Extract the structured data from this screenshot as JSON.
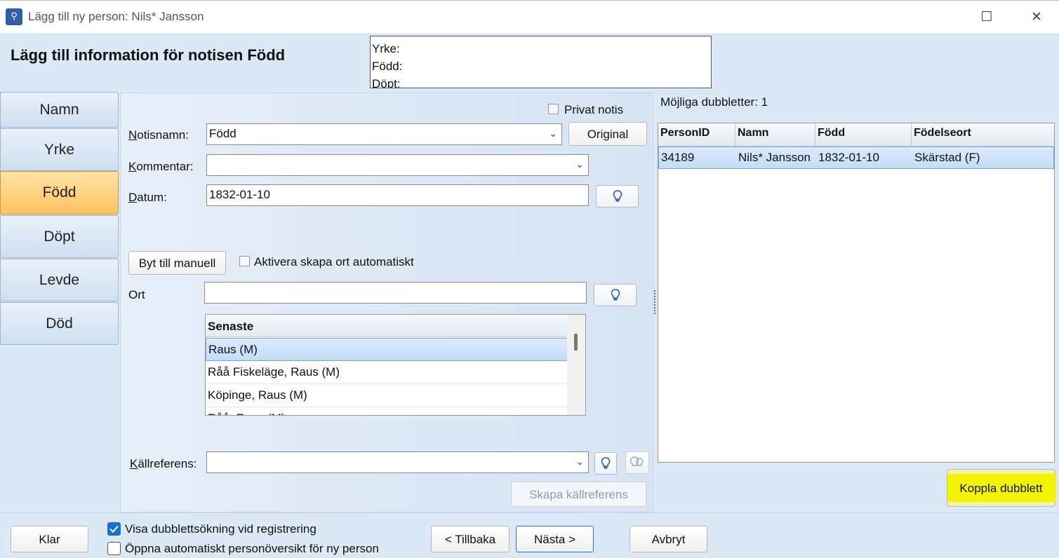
{
  "window": {
    "title": "Lägg till ny person: Nils* Jansson",
    "icon": "family-tree-icon",
    "minimize": "—",
    "maximize": "☐",
    "close": "✕"
  },
  "header": {
    "heading": "Lägg till information för notisen Född",
    "summary": [
      "Yrke:",
      "Född:",
      "Döpt:"
    ]
  },
  "nav": {
    "items": [
      {
        "label": "Namn",
        "active": false
      },
      {
        "label": "Yrke",
        "active": false
      },
      {
        "label": "Född",
        "active": true
      },
      {
        "label": "Döpt",
        "active": false
      },
      {
        "label": "Levde",
        "active": false
      },
      {
        "label": "Död",
        "active": false
      }
    ]
  },
  "form": {
    "private_label": "Privat notis",
    "notisnamn_label_u": "N",
    "notisnamn_label_rest": "otisnamn:",
    "notisnamn_value": "Född",
    "original_button": "Original",
    "kommentar_label_u": "K",
    "kommentar_label_rest": "ommentar:",
    "kommentar_value": "",
    "datum_label_u": "D",
    "datum_label_rest": "atum:",
    "datum_value": "1832-01-10",
    "manual_button": "Byt till manuell",
    "auto_place_label": "Aktivera skapa ort automatiskt",
    "ort_label": "Ort",
    "ort_value": "",
    "recent_header": "Senaste",
    "recent_places": [
      "Raus (M)",
      "Råå Fiskeläge, Raus (M)",
      "Köpinge, Raus (M)",
      "Råå, Raus (M)"
    ],
    "source_label_u": "K",
    "source_label_rest": "ällreferens:",
    "source_value": "",
    "create_source_button": "Skapa källreferens"
  },
  "duplicates": {
    "label": "Möjliga dubbletter: 1",
    "columns": [
      "PersonID",
      "Namn",
      "Född",
      "Födelseort"
    ],
    "rows": [
      {
        "id": "34189",
        "name": "Nils* Jansson",
        "born": "1832-01-10",
        "place": "Skärstad (F)"
      }
    ],
    "link_button": "Koppla dubblett",
    "highlight_color": "#f4f400"
  },
  "footer": {
    "done_button": "Klar",
    "show_dup_label": "Visa dubblettsökning vid registrering",
    "show_dup_checked": true,
    "open_overview_label": "Öppna automatiskt personöversikt för ny person",
    "open_overview_checked": false,
    "back_button": "< Tillbaka",
    "next_button": "Nästa >",
    "cancel_button": "Avbryt"
  }
}
